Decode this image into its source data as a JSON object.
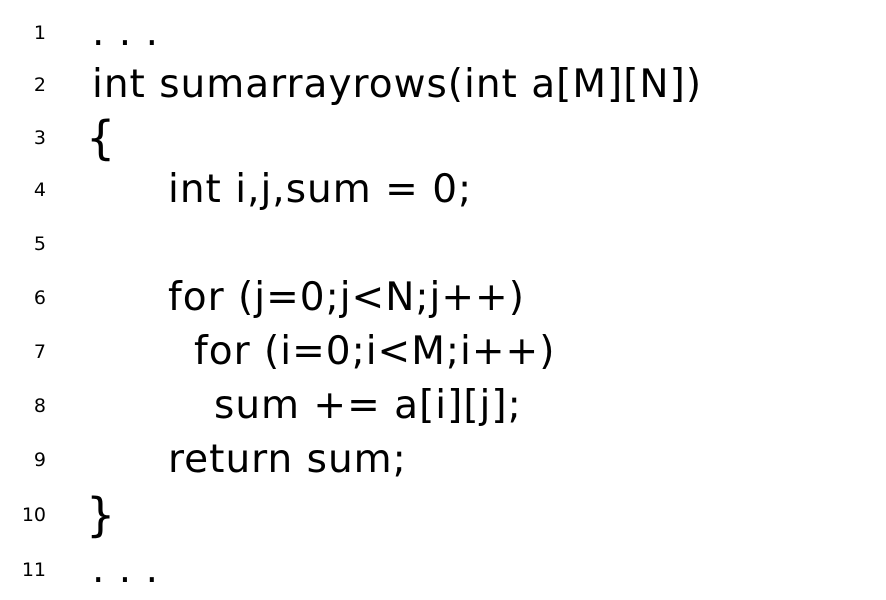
{
  "listing": {
    "lines": [
      {
        "number": "1",
        "text": ". . ."
      },
      {
        "number": "2",
        "text": "int sumarrayrows(int a[M][N])"
      },
      {
        "number": "3",
        "text": "{"
      },
      {
        "number": "4",
        "text": "int i,j,sum = 0;"
      },
      {
        "number": "5",
        "text": ""
      },
      {
        "number": "6",
        "text": "for (j=0;j<N;j++)"
      },
      {
        "number": "7",
        "text": "for (i=0;i<M;i++)"
      },
      {
        "number": "8",
        "text": "sum += a[i][j];"
      },
      {
        "number": "9",
        "text": "return sum;"
      },
      {
        "number": "10",
        "text": "}"
      },
      {
        "number": "11",
        "text": ". . ."
      }
    ]
  }
}
